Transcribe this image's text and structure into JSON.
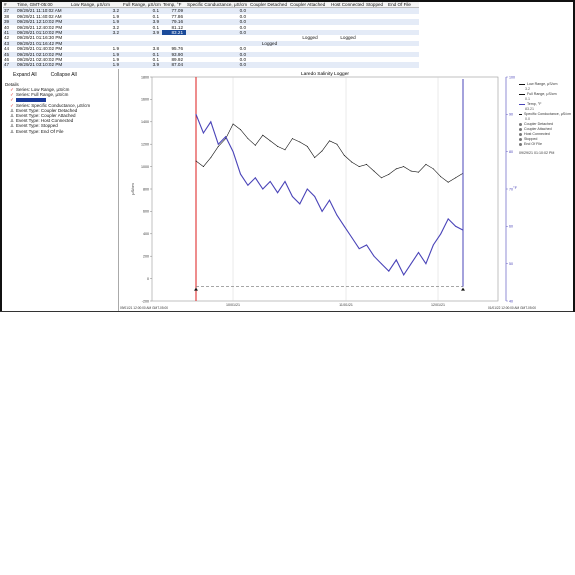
{
  "table": {
    "headers": [
      "#",
      "Time, GMT-05:00",
      "Low Range, μS/cm",
      "Full Range, μS/cm",
      "Temp, °F",
      "Specific Conductance, μS/cm",
      "Coupler Detached",
      "Coupler Attached",
      "Host Connected",
      "Stopped",
      "End Of File"
    ],
    "rows": [
      [
        "37",
        "09/29/21 11:10:02 AM",
        "3.2",
        "0.1",
        "77.09",
        "0.0",
        "",
        "",
        "",
        "",
        ""
      ],
      [
        "38",
        "09/29/21 11:40:02 AM",
        "1.9",
        "0.1",
        "77.86",
        "0.0",
        "",
        "",
        "",
        "",
        ""
      ],
      [
        "39",
        "09/29/21 12:10:02 PM",
        "1.9",
        "3.9",
        "79.16",
        "0.0",
        "",
        "",
        "",
        "",
        ""
      ],
      [
        "40",
        "09/29/21 12:40:02 PM",
        "3.2",
        "0.1",
        "81.12",
        "0.0",
        "",
        "",
        "",
        "",
        ""
      ],
      [
        "41",
        "09/29/21 01:10:02 PM",
        "3.2",
        "3.9",
        "83.21",
        "0.0",
        "",
        "",
        "",
        "",
        ""
      ],
      [
        "42",
        "09/29/21 01:16:30 PM",
        "",
        "",
        "",
        "",
        "",
        "Logged",
        "Logged",
        "",
        ""
      ],
      [
        "43",
        "09/29/21 01:16:42 PM",
        "",
        "",
        "",
        "",
        "Logged",
        "",
        "",
        "",
        ""
      ],
      [
        "44",
        "09/29/21 01:40:02 PM",
        "1.9",
        "3.8",
        "95.76",
        "0.0",
        "",
        "",
        "",
        "",
        ""
      ],
      [
        "45",
        "09/29/21 02:10:02 PM",
        "1.9",
        "0.1",
        "93.90",
        "0.0",
        "",
        "",
        "",
        "",
        ""
      ],
      [
        "46",
        "09/29/21 02:40:02 PM",
        "1.9",
        "0.1",
        "89.92",
        "0.0",
        "",
        "",
        "",
        "",
        ""
      ],
      [
        "47",
        "09/29/21 03:10:02 PM",
        "1.9",
        "3.9",
        "87.04",
        "0.0",
        "",
        "",
        "",
        "",
        ""
      ]
    ]
  },
  "tree": {
    "expand_all": "Expand All",
    "collapse_all": "Collapse All",
    "details": "Details",
    "items": [
      {
        "label": "Series: Low Range, μS/cm",
        "icon": "check-icon"
      },
      {
        "label": "Series: Full Range, μS/cm",
        "icon": "check-icon"
      },
      {
        "label": "",
        "icon": "check-icon",
        "highlighted": true
      },
      {
        "label": "Series: Specific Conductance, μS/cm",
        "icon": "check-icon"
      },
      {
        "label": "Event Type: Coupler Detached",
        "icon": "event-icon"
      },
      {
        "label": "Event Type: Coupler Attached",
        "icon": "event-icon"
      },
      {
        "label": "Event Type: Host Connected",
        "icon": "event-icon"
      },
      {
        "label": "Event Type: Stopped",
        "icon": "event-icon"
      },
      {
        "label": "Event Type: End Of File",
        "icon": "event-icon"
      }
    ]
  },
  "chart_data": {
    "type": "line",
    "title": "Laredo Salinity Logger",
    "ylabel": "μS/cm",
    "y2label": "°F",
    "ylim": [
      -200,
      1800
    ],
    "y2lim": [
      40,
      100
    ],
    "yticks": [
      "1800",
      "1600",
      "1400",
      "1200",
      "1000",
      "800",
      "600",
      "400",
      "200",
      "0",
      "-200"
    ],
    "y2ticks": [
      "100",
      "90",
      "80",
      "70",
      "60",
      "50",
      "40"
    ],
    "xticks": [
      "10/01/21",
      "11/01/21",
      "12/01/21"
    ],
    "x_start_label": "09/01/21 12:00:00 AM GMT-05:00",
    "x_end_label": "01/01/22 12:00:00 AM GMT-05:00",
    "series": [
      {
        "name": "Specific Conductance, μS/cm",
        "color": "#111111",
        "axis": "left",
        "values": [
          1050,
          1000,
          1080,
          1180,
          1250,
          1380,
          1330,
          1250,
          1190,
          1280,
          1230,
          1180,
          1150,
          1250,
          1220,
          1180,
          1080,
          1140,
          1230,
          1200,
          1100,
          1040,
          1000,
          1020,
          960,
          900,
          930,
          980,
          1000,
          960,
          950,
          1020,
          980,
          910,
          860,
          900,
          940
        ]
      },
      {
        "name": "Temp, °F",
        "color": "#4a44b8",
        "axis": "right",
        "values": [
          90,
          85,
          88,
          82,
          84,
          80,
          74,
          71,
          73,
          70,
          72,
          69,
          72,
          68,
          66,
          70,
          68,
          64,
          67,
          63,
          60,
          57,
          54,
          55,
          52,
          50,
          48,
          51,
          47,
          50,
          53,
          50,
          55,
          58,
          62,
          60,
          59
        ]
      }
    ],
    "legend": {
      "entries": [
        {
          "label": "Low Range, μS/cm",
          "sub": "3.2",
          "color": "#111111"
        },
        {
          "label": "Full Range, μS/cm",
          "sub": "0.1",
          "color": "#111111"
        },
        {
          "label": "Temp, °F",
          "sub": "83.21",
          "color": "#4a44b8"
        },
        {
          "label": "Specific Conductance, μS/cm",
          "sub": "0.0",
          "color": "#111111"
        },
        {
          "label": "Coupler Detached",
          "sub": "",
          "color": "#777777"
        },
        {
          "label": "Coupler Attached",
          "sub": "",
          "color": "#777777"
        },
        {
          "label": "Host Connected",
          "sub": "",
          "color": "#777777"
        },
        {
          "label": "Stopped",
          "sub": "",
          "color": "#777777"
        },
        {
          "label": "End Of File",
          "sub": "",
          "color": "#777777"
        }
      ],
      "timestamp": "09/29/21 01:10:02 PM"
    }
  },
  "colors": {
    "row_alt": "#e4ebf7",
    "selection": "#1a4a9a",
    "cursor_line": "#e03030",
    "temp_series": "#4a44b8"
  }
}
